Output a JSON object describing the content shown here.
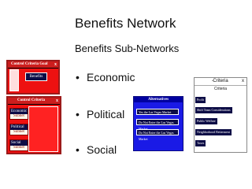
{
  "slide": {
    "title": "Benefits Network",
    "subtitle": "Benefits Sub-Networks",
    "bullets": [
      "Economic",
      "Political",
      "Social"
    ]
  },
  "panel1": {
    "header": "Control Criteria Goal",
    "close": "x",
    "button": "Benefits"
  },
  "panel2": {
    "header": "Control Criteria",
    "close": "x",
    "items": [
      {
        "title": "Economic",
        "sub": "Subnet"
      },
      {
        "title": "Political",
        "sub": "Subnet"
      },
      {
        "title": "Social",
        "sub": "Subnet"
      }
    ]
  },
  "panel3": {
    "header": "Alternatives",
    "rows": [
      "Yes the Las Vegas Market",
      "Do Not Enter the Las Vegas Market",
      "Do Not Enter the Las Vegas Market"
    ]
  },
  "panel4": {
    "header": "Criteria",
    "left_mark": "-",
    "right_mark": "x",
    "sub": "Criteria",
    "items": [
      "Profit",
      "Shift Team Considerations",
      "Public Welfare",
      "Neighborhood Betterment",
      "Taxes"
    ]
  }
}
